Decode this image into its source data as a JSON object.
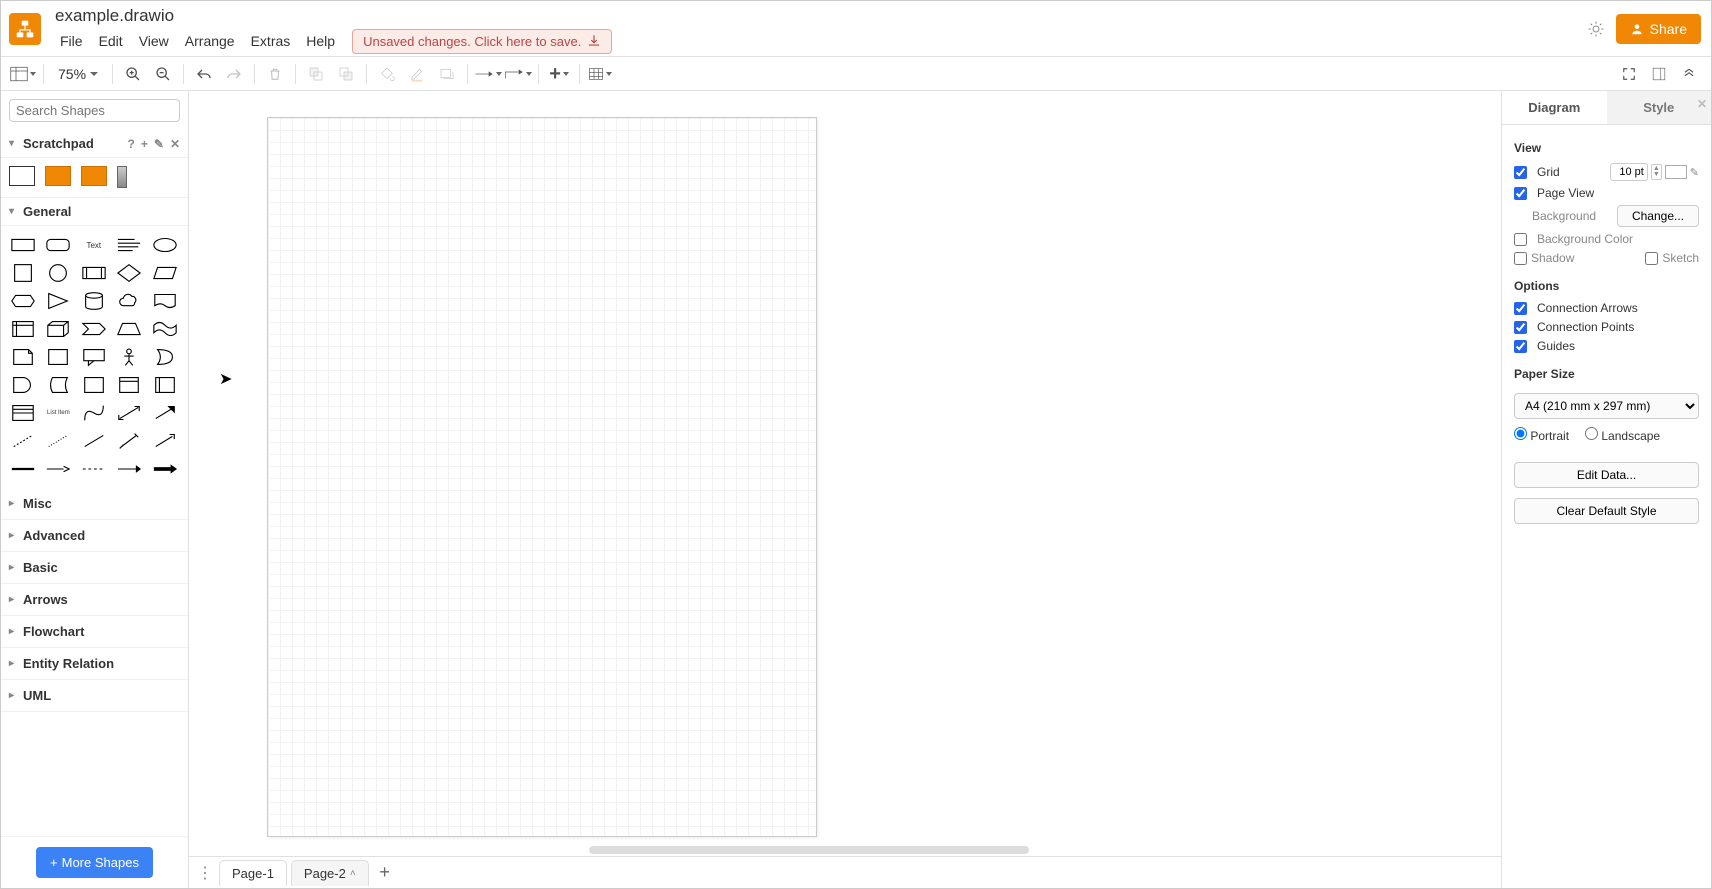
{
  "header": {
    "filename": "example.drawio",
    "menus": [
      "File",
      "Edit",
      "View",
      "Arrange",
      "Extras",
      "Help"
    ],
    "unsaved_text": "Unsaved changes. Click here to save.",
    "share_label": "Share"
  },
  "toolbar": {
    "zoom": "75%"
  },
  "sidebar_left": {
    "search_placeholder": "Search Shapes",
    "scratchpad_title": "Scratchpad",
    "general_title": "General",
    "collapsed_panels": [
      "Misc",
      "Advanced",
      "Basic",
      "Arrows",
      "Flowchart",
      "Entity Relation",
      "UML"
    ],
    "more_shapes_label": "More Shapes"
  },
  "tabs": {
    "pages": [
      "Page-1",
      "Page-2"
    ],
    "active_index": 1
  },
  "right": {
    "tabs": {
      "diagram": "Diagram",
      "style": "Style"
    },
    "view_title": "View",
    "grid_label": "Grid",
    "grid_size": "10 pt",
    "pageview_label": "Page View",
    "background_label": "Background",
    "change_label": "Change...",
    "bgcolor_label": "Background Color",
    "shadow_label": "Shadow",
    "sketch_label": "Sketch",
    "options_title": "Options",
    "conn_arrows_label": "Connection Arrows",
    "conn_points_label": "Connection Points",
    "guides_label": "Guides",
    "papersize_title": "Paper Size",
    "papersize_value": "A4 (210 mm x 297 mm)",
    "portrait_label": "Portrait",
    "landscape_label": "Landscape",
    "edit_data_label": "Edit Data...",
    "clear_style_label": "Clear Default Style"
  }
}
